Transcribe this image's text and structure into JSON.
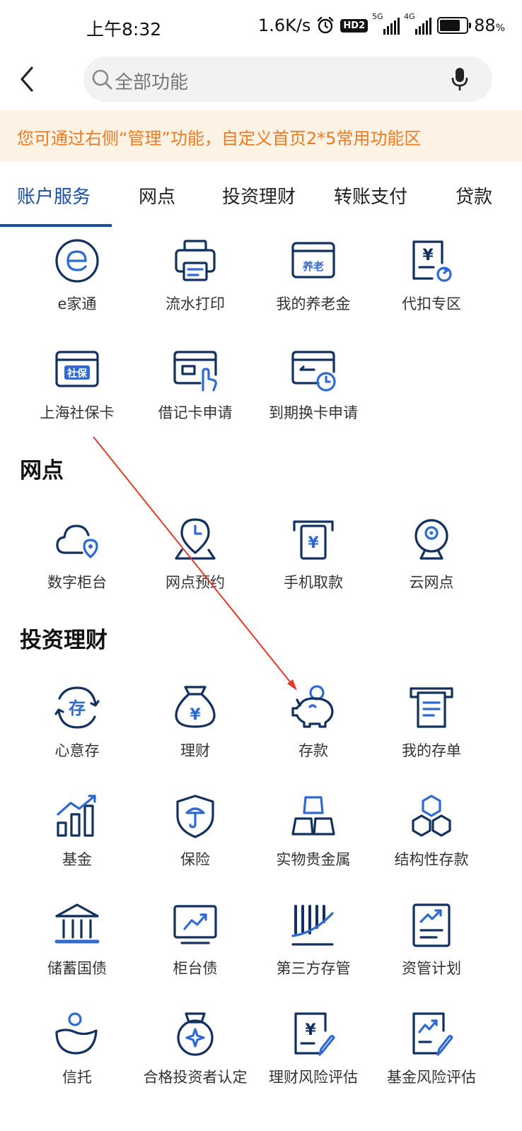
{
  "status_bar": {
    "time": "上午8:32",
    "net_speed": "1.6K/s",
    "hd_badge": "HD2",
    "sig1_label": "5G",
    "sig2_label": "4G",
    "battery_level": 88,
    "battery_text": "88",
    "battery_unit": "%"
  },
  "search": {
    "placeholder": "全部功能"
  },
  "banner": {
    "text": "您可通过右侧“管理”功能，自定义首页2*5常用功能区"
  },
  "tabs": [
    {
      "label": "账户服务",
      "active": true
    },
    {
      "label": "网点",
      "active": false
    },
    {
      "label": "投资理财",
      "active": false
    },
    {
      "label": "转账支付",
      "active": false
    },
    {
      "label": "贷款",
      "active": false
    }
  ],
  "sections": {
    "account": {
      "items": [
        {
          "label": "e家通",
          "icon": "e-home-icon"
        },
        {
          "label": "流水打印",
          "icon": "printer-icon"
        },
        {
          "label": "我的养老金",
          "icon": "pension-card-icon",
          "badge": "养老"
        },
        {
          "label": "代扣专区",
          "icon": "withholding-icon",
          "badge": "¥"
        },
        {
          "label": "上海社保卡",
          "icon": "social-security-card-icon",
          "badge": "社保"
        },
        {
          "label": "借记卡申请",
          "icon": "debit-card-icon"
        },
        {
          "label": "到期换卡申请",
          "icon": "card-renewal-icon"
        }
      ]
    },
    "outlets": {
      "title": "网点",
      "items": [
        {
          "label": "数字柜台",
          "icon": "cloud-location-icon"
        },
        {
          "label": "网点预约",
          "icon": "appointment-icon"
        },
        {
          "label": "手机取款",
          "icon": "atm-withdraw-icon",
          "badge": "¥"
        },
        {
          "label": "云网点",
          "icon": "webcam-icon"
        }
      ]
    },
    "investment": {
      "title": "投资理财",
      "items": [
        {
          "label": "心意存",
          "icon": "deposit-cycle-icon",
          "badge": "存"
        },
        {
          "label": "理财",
          "icon": "money-bag-icon",
          "badge": "¥"
        },
        {
          "label": "存款",
          "icon": "piggy-bank-icon"
        },
        {
          "label": "我的存单",
          "icon": "certificate-icon"
        },
        {
          "label": "基金",
          "icon": "fund-chart-icon"
        },
        {
          "label": "保险",
          "icon": "insurance-shield-icon"
        },
        {
          "label": "实物贵金属",
          "icon": "gold-bars-icon"
        },
        {
          "label": "结构性存款",
          "icon": "hexagons-icon"
        },
        {
          "label": "储蓄国债",
          "icon": "bank-building-icon"
        },
        {
          "label": "柜台债",
          "icon": "monitor-trend-icon"
        },
        {
          "label": "第三方存管",
          "icon": "custody-icon"
        },
        {
          "label": "资管计划",
          "icon": "plan-document-icon"
        },
        {
          "label": "信托",
          "icon": "trust-icon"
        },
        {
          "label": "合格投资者认定",
          "icon": "medal-icon"
        },
        {
          "label": "理财风险评估",
          "icon": "risk-assess-icon",
          "badge": "¥"
        },
        {
          "label": "基金风险评估",
          "icon": "fund-risk-icon"
        }
      ]
    }
  },
  "colors": {
    "accent": "#1a4ea8",
    "icon_dark": "#13315f",
    "icon_blue": "#2f6ad2",
    "banner_bg": "#fdf3e5",
    "banner_text": "#ee7a22",
    "arrow": "#e03a2f"
  }
}
